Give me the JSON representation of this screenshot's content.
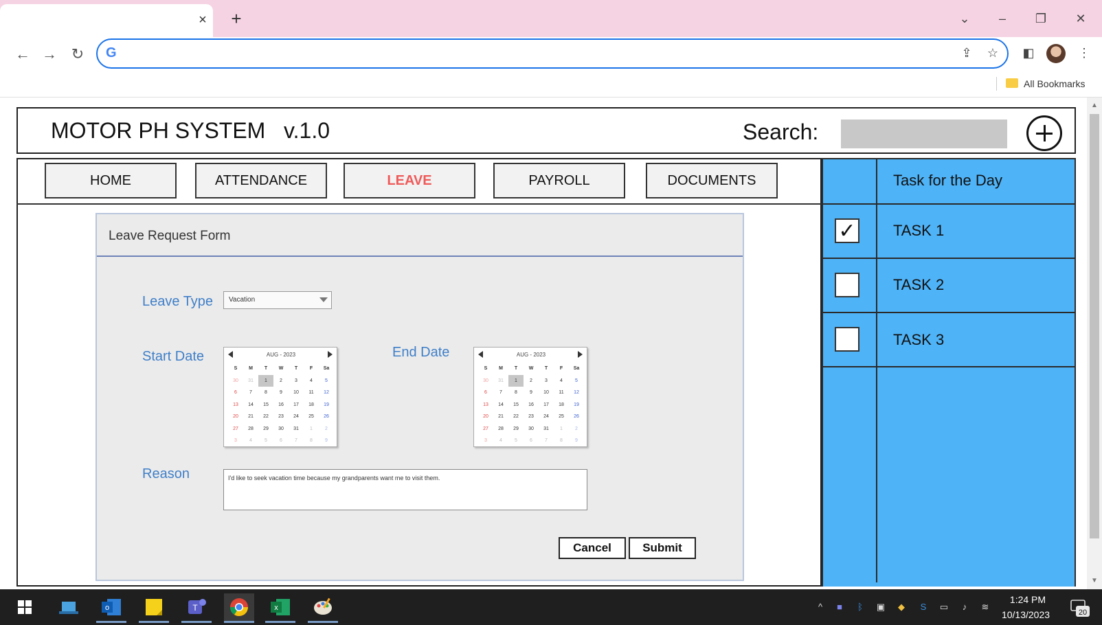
{
  "browser": {
    "tab_close": "×",
    "new_tab": "+",
    "window_controls": [
      "⌄",
      "–",
      "❐",
      "✕"
    ],
    "nav": {
      "back": "←",
      "forward": "→",
      "reload": "↻"
    },
    "omnibox_icon": "G",
    "omnibox_value": "",
    "bookmarks_label": "All Bookmarks"
  },
  "app": {
    "title": "MOTOR PH SYSTEM   v.1.0",
    "search_label": "Search:",
    "search_value": ""
  },
  "nav": {
    "tabs": [
      {
        "label": "HOME"
      },
      {
        "label": "ATTENDANCE"
      },
      {
        "label": "LEAVE",
        "active": true
      },
      {
        "label": "PAYROLL"
      },
      {
        "label": "DOCUMENTS"
      }
    ]
  },
  "form": {
    "title": "Leave Request Form",
    "leave_type_label": "Leave Type",
    "leave_type_value": "Vacation",
    "start_date_label": "Start Date",
    "end_date_label": "End Date",
    "reason_label": "Reason",
    "reason_value": "I'd like to seek vacation time because my grandparents want me to visit them.",
    "cancel_label": "Cancel",
    "submit_label": "Submit"
  },
  "calendar": {
    "month_label": "AUG - 2023",
    "weekdays": [
      "S",
      "M",
      "T",
      "W",
      "T",
      "F",
      "Sa"
    ],
    "days": [
      "30",
      "31",
      "1",
      "2",
      "3",
      "4",
      "5",
      "6",
      "7",
      "8",
      "9",
      "10",
      "11",
      "12",
      "13",
      "14",
      "15",
      "16",
      "17",
      "18",
      "19",
      "20",
      "21",
      "22",
      "23",
      "24",
      "25",
      "26",
      "27",
      "28",
      "29",
      "30",
      "31",
      "1",
      "2",
      "3",
      "4",
      "5",
      "6",
      "7",
      "8",
      "9"
    ],
    "selected_day": "1"
  },
  "tasks": {
    "header": "Task for the Day",
    "items": [
      {
        "label": "TASK 1",
        "checked": true
      },
      {
        "label": "TASK 2",
        "checked": false
      },
      {
        "label": "TASK 3",
        "checked": false
      }
    ]
  },
  "taskbar": {
    "time": "1:24 PM",
    "date": "10/13/2023",
    "notification_count": "20",
    "apps": [
      "windows-start-icon",
      "file-explorer-icon",
      "outlook-icon",
      "sticky-notes-icon",
      "teams-icon",
      "chrome-icon",
      "excel-icon",
      "paint-icon"
    ]
  },
  "colors": {
    "tab_strip": "#f6d3e3",
    "active_nav": "#ef5a5a",
    "form_label": "#3f7fc8",
    "task_panel": "#4fb3f7"
  }
}
